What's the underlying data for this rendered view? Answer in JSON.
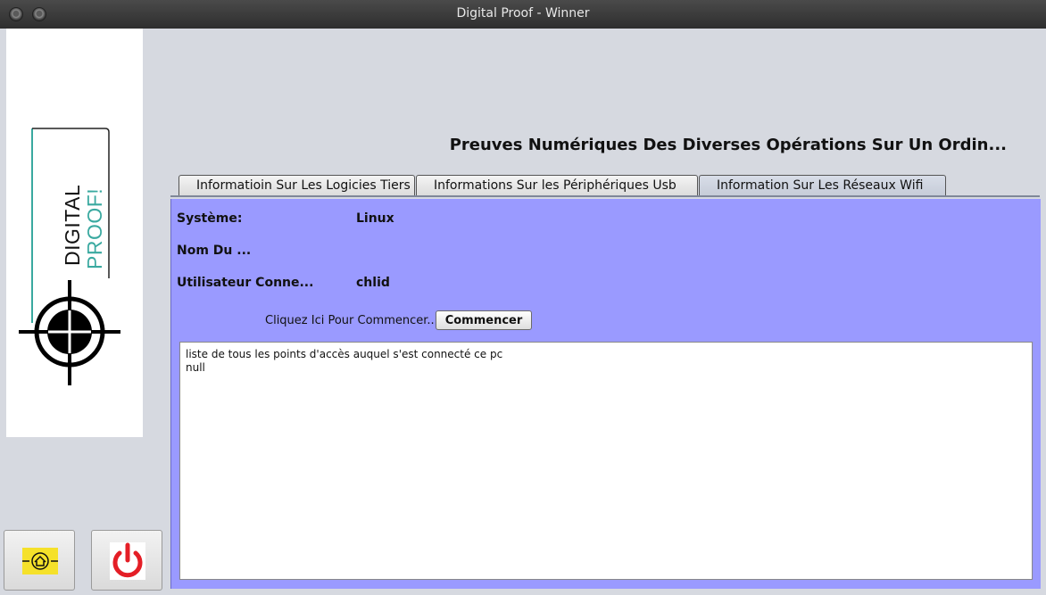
{
  "window": {
    "title": "Digital Proof - Winner"
  },
  "logo": {
    "line1": "DIGITAL",
    "line2": "PROOF!",
    "accent_color": "#3aa9a0"
  },
  "heading": "Preuves Numériques Des Diverses Opérations Sur Un Ordin...",
  "tabs": [
    {
      "label": "Informatioin Sur Les Logicies Tiers",
      "active": false
    },
    {
      "label": "Informations Sur les Périphériques Usb",
      "active": false
    },
    {
      "label": "Information Sur Les Réseaux Wifi",
      "active": true
    }
  ],
  "info": {
    "system_label": "Système:",
    "system_value": "Linux",
    "name_label": "Nom Du ...",
    "name_value": "",
    "user_label": "Utilisateur Conne...",
    "user_value": "chlid"
  },
  "actions": {
    "prompt": "Cliquez Ici Pour Commencer...",
    "start_label": "Commencer"
  },
  "output": {
    "line1": "liste de tous les points d'accès auquel s'est connecté ce pc",
    "line2": "null"
  },
  "bottom_buttons": {
    "home_icon": "home-icon",
    "power_icon": "power-icon"
  },
  "colors": {
    "panel_bg": "#9a9aff",
    "power_red": "#e41e26",
    "home_yellow": "#f5e12a"
  }
}
